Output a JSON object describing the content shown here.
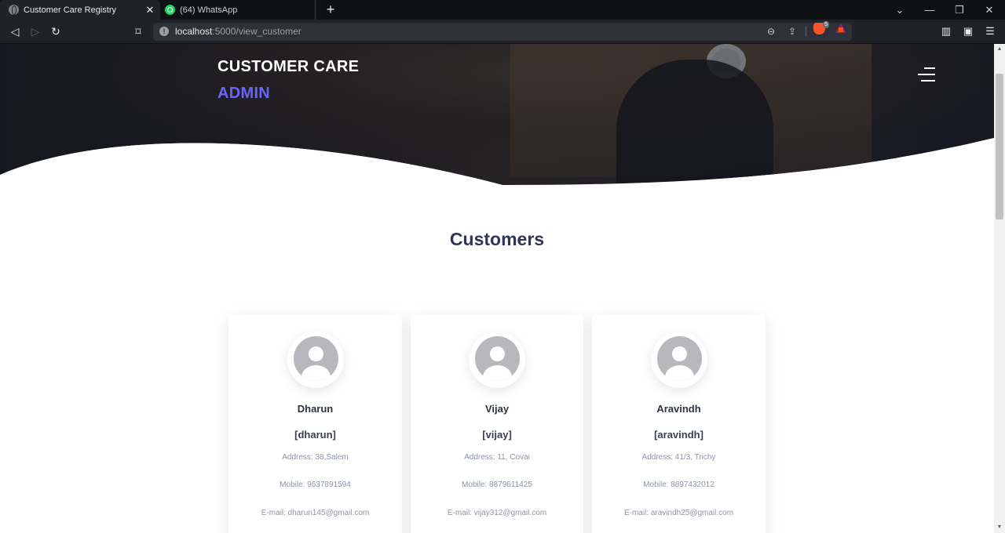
{
  "browser": {
    "tabs": [
      {
        "title": "Customer Care Registry",
        "active": true
      },
      {
        "title": "(64) WhatsApp",
        "active": false
      }
    ],
    "url_host": "localhost",
    "url_path": ":5000/view_customer",
    "brave_badge": "5"
  },
  "header": {
    "brand_line1": "CUSTOMER CARE",
    "brand_line2": "ADMIN",
    "accent_color": "#6c63ff"
  },
  "page": {
    "heading": "Customers"
  },
  "customers": [
    {
      "name": "Dharun",
      "username": "[dharun]",
      "address": "Address: 38,Salem",
      "mobile": "Mobile: 9637891594",
      "email": "E-mail: dharun145@gmail.com"
    },
    {
      "name": "Vijay",
      "username": "[vijay]",
      "address": "Address: 11, Covai",
      "mobile": "Mobile: 8879611425",
      "email": "E-mail: vijay312@gmail.com"
    },
    {
      "name": "Aravindh",
      "username": "[aravindh]",
      "address": "Address: 41/3, Trichy",
      "mobile": "Mobile: 8897432012",
      "email": "E-mail: aravindh25@gmail.com"
    }
  ]
}
